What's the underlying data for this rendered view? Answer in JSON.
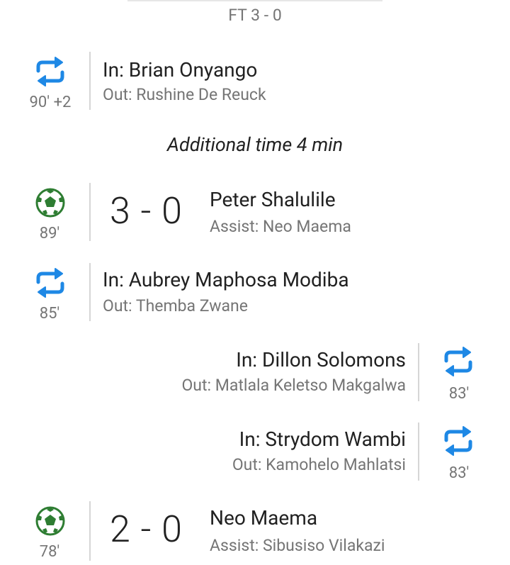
{
  "header": {
    "full_time": "FT 3 - 0"
  },
  "additional_time": "Additional time 4 min",
  "colors": {
    "sub_icon": "#1E88E5",
    "goal_icon": "#2E7D32",
    "muted": "#757575",
    "text": "#212121"
  },
  "events": [
    {
      "type": "substitution",
      "side": "home",
      "minute": "90' +2",
      "in": "In: Brian Onyango",
      "out": "Out: Rushine De Reuck",
      "icon": "substitution-icon"
    },
    {
      "type": "goal",
      "side": "home",
      "minute": "89'",
      "score": "3 - 0",
      "scorer": "Peter Shalulile",
      "assist": "Assist: Neo Maema",
      "icon": "soccer-ball-icon"
    },
    {
      "type": "substitution",
      "side": "home",
      "minute": "85'",
      "in": "In: Aubrey Maphosa Modiba",
      "out": "Out: Themba Zwane",
      "icon": "substitution-icon"
    },
    {
      "type": "substitution",
      "side": "away",
      "minute": "83'",
      "in": "In: Dillon Solomons",
      "out": "Out: Matlala Keletso Makgalwa",
      "icon": "substitution-icon"
    },
    {
      "type": "substitution",
      "side": "away",
      "minute": "83'",
      "in": "In: Strydom Wambi",
      "out": "Out: Kamohelo Mahlatsi",
      "icon": "substitution-icon"
    },
    {
      "type": "goal",
      "side": "home",
      "minute": "78'",
      "score": "2 - 0",
      "scorer": "Neo Maema",
      "assist": "Assist: Sibusiso Vilakazi",
      "icon": "soccer-ball-icon"
    }
  ]
}
